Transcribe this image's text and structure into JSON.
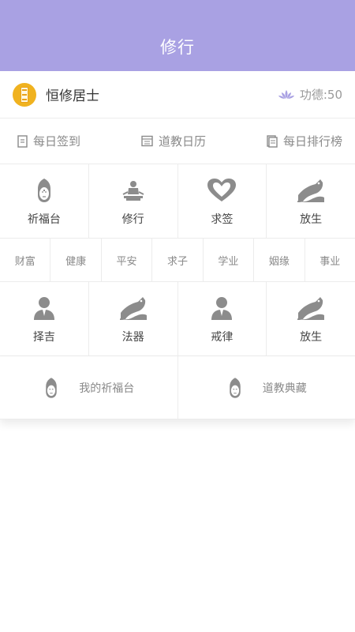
{
  "header": {
    "title": "修行"
  },
  "user": {
    "name": "恒修居士",
    "merit": "功德:50"
  },
  "quick_links": [
    {
      "label": "每日签到",
      "icon": "checkin-icon"
    },
    {
      "label": "道教日历",
      "icon": "calendar-icon"
    },
    {
      "label": "每日排行榜",
      "icon": "ranking-icon"
    }
  ],
  "grid_top": [
    {
      "label": "祈福台",
      "icon": "buddha-head-icon"
    },
    {
      "label": "修行",
      "icon": "meditation-icon"
    },
    {
      "label": "求签",
      "icon": "heart-hands-icon"
    },
    {
      "label": "放生",
      "icon": "fish-wave-icon"
    }
  ],
  "tags": [
    "财富",
    "健康",
    "平安",
    "求子",
    "学业",
    "姻缘",
    "事业"
  ],
  "grid_mid": [
    {
      "label": "择吉",
      "icon": "person-icon"
    },
    {
      "label": "法器",
      "icon": "fish-wave-icon"
    },
    {
      "label": "戒律",
      "icon": "person-icon"
    },
    {
      "label": "放生",
      "icon": "fish-wave-icon"
    }
  ],
  "bottom": [
    {
      "label": "我的祈福台",
      "icon": "buddha-head-icon"
    },
    {
      "label": "道教典藏",
      "icon": "buddha-head-icon"
    }
  ],
  "colors": {
    "header_bg": "#a9a1e3",
    "icon_gray": "#8c8c8c",
    "avatar_gold": "#f0b21f",
    "lotus_purple": "#a9a1e3"
  }
}
